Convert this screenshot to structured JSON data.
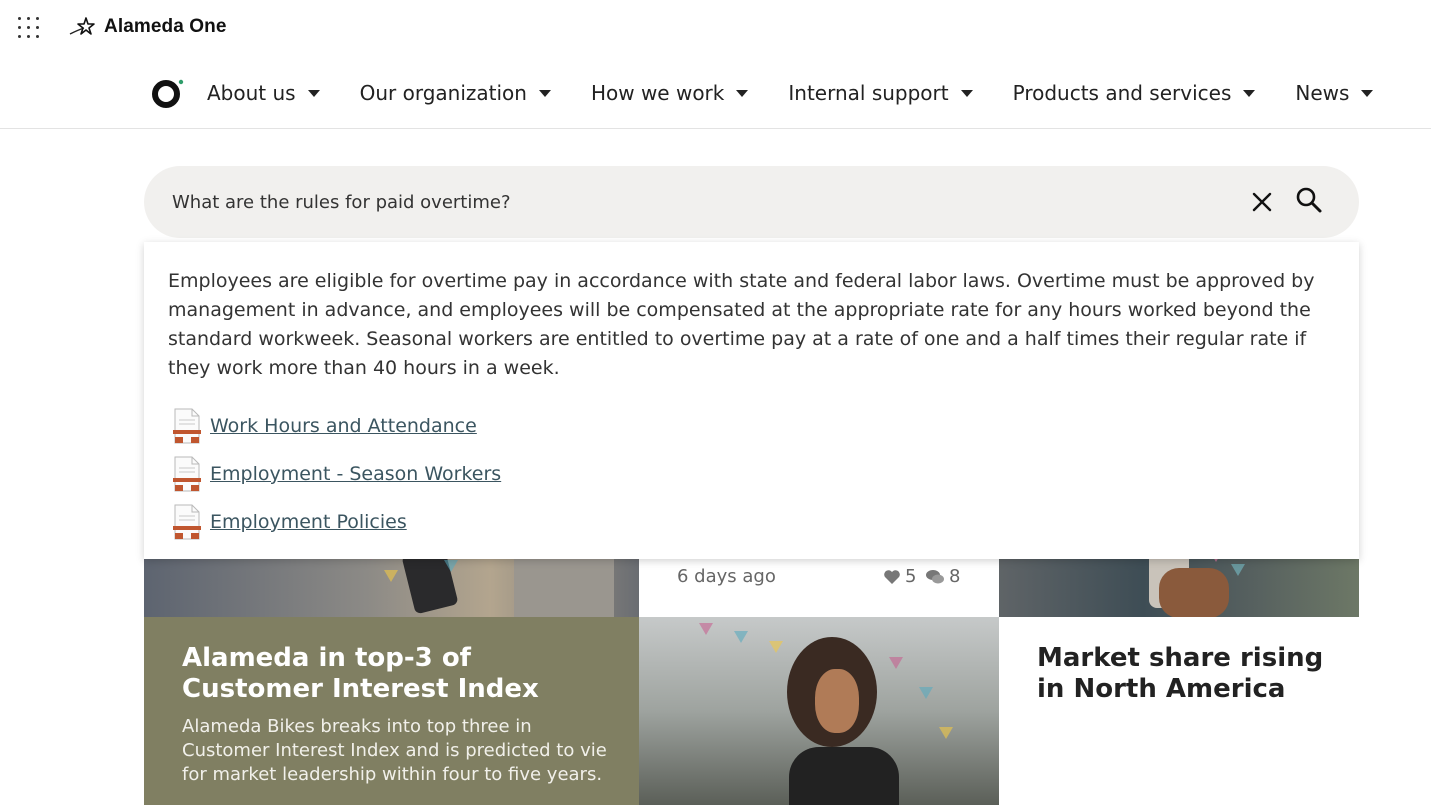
{
  "app": {
    "brand_name": "Alameda One"
  },
  "nav": {
    "items": [
      {
        "label": "About us"
      },
      {
        "label": "Our organization"
      },
      {
        "label": "How we work"
      },
      {
        "label": "Internal support"
      },
      {
        "label": "Products and services"
      },
      {
        "label": "News"
      }
    ]
  },
  "search": {
    "query": "What are the rules for paid overtime?"
  },
  "answer": {
    "text": "Employees are eligible for overtime pay in accordance with state and federal labor laws. Overtime must be approved by management in advance, and employees will be compensated at the appropriate rate for any hours worked beyond the standard workweek. Seasonal workers are entitled to overtime pay at a rate of one and a half times their regular rate if they work more than 40 hours in a week.",
    "sources": [
      {
        "title": "Work Hours and Attendance"
      },
      {
        "title": "Employment - Season Workers"
      },
      {
        "title": "Employment Policies"
      }
    ]
  },
  "cards": {
    "meta": {
      "date": "6 days ago",
      "likes": "5",
      "comments": "8"
    },
    "feature": {
      "title": "Alameda in top-3 of Customer Interest Index",
      "summary": "Alameda Bikes breaks into top three in Customer Interest Index and is predicted to vie for market leadership within four to five years."
    },
    "side": {
      "title": "Market share rising in North America"
    }
  },
  "colors": {
    "search_bg": "#f1f0ee",
    "feature_card": "#807f62",
    "link": "#3b5560",
    "doc_icon_accent": "#c0562f"
  },
  "icons": [
    "app-launcher-icon",
    "brand-logo-icon",
    "home-logo-icon",
    "caret-down-icon",
    "close-icon",
    "search-icon",
    "document-icon",
    "heart-icon",
    "comment-icon"
  ]
}
